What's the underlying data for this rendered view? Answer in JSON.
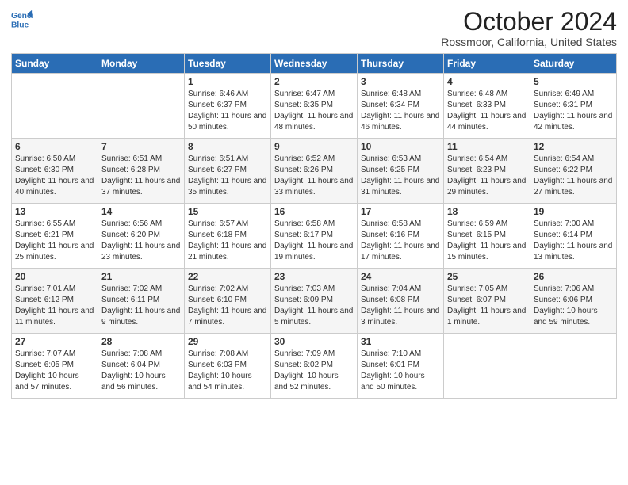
{
  "logo": {
    "line1": "General",
    "line2": "Blue"
  },
  "header": {
    "month": "October 2024",
    "location": "Rossmoor, California, United States"
  },
  "weekdays": [
    "Sunday",
    "Monday",
    "Tuesday",
    "Wednesday",
    "Thursday",
    "Friday",
    "Saturday"
  ],
  "weeks": [
    [
      {
        "day": "",
        "sunrise": "",
        "sunset": "",
        "daylight": ""
      },
      {
        "day": "",
        "sunrise": "",
        "sunset": "",
        "daylight": ""
      },
      {
        "day": "1",
        "sunrise": "Sunrise: 6:46 AM",
        "sunset": "Sunset: 6:37 PM",
        "daylight": "Daylight: 11 hours and 50 minutes."
      },
      {
        "day": "2",
        "sunrise": "Sunrise: 6:47 AM",
        "sunset": "Sunset: 6:35 PM",
        "daylight": "Daylight: 11 hours and 48 minutes."
      },
      {
        "day": "3",
        "sunrise": "Sunrise: 6:48 AM",
        "sunset": "Sunset: 6:34 PM",
        "daylight": "Daylight: 11 hours and 46 minutes."
      },
      {
        "day": "4",
        "sunrise": "Sunrise: 6:48 AM",
        "sunset": "Sunset: 6:33 PM",
        "daylight": "Daylight: 11 hours and 44 minutes."
      },
      {
        "day": "5",
        "sunrise": "Sunrise: 6:49 AM",
        "sunset": "Sunset: 6:31 PM",
        "daylight": "Daylight: 11 hours and 42 minutes."
      }
    ],
    [
      {
        "day": "6",
        "sunrise": "Sunrise: 6:50 AM",
        "sunset": "Sunset: 6:30 PM",
        "daylight": "Daylight: 11 hours and 40 minutes."
      },
      {
        "day": "7",
        "sunrise": "Sunrise: 6:51 AM",
        "sunset": "Sunset: 6:28 PM",
        "daylight": "Daylight: 11 hours and 37 minutes."
      },
      {
        "day": "8",
        "sunrise": "Sunrise: 6:51 AM",
        "sunset": "Sunset: 6:27 PM",
        "daylight": "Daylight: 11 hours and 35 minutes."
      },
      {
        "day": "9",
        "sunrise": "Sunrise: 6:52 AM",
        "sunset": "Sunset: 6:26 PM",
        "daylight": "Daylight: 11 hours and 33 minutes."
      },
      {
        "day": "10",
        "sunrise": "Sunrise: 6:53 AM",
        "sunset": "Sunset: 6:25 PM",
        "daylight": "Daylight: 11 hours and 31 minutes."
      },
      {
        "day": "11",
        "sunrise": "Sunrise: 6:54 AM",
        "sunset": "Sunset: 6:23 PM",
        "daylight": "Daylight: 11 hours and 29 minutes."
      },
      {
        "day": "12",
        "sunrise": "Sunrise: 6:54 AM",
        "sunset": "Sunset: 6:22 PM",
        "daylight": "Daylight: 11 hours and 27 minutes."
      }
    ],
    [
      {
        "day": "13",
        "sunrise": "Sunrise: 6:55 AM",
        "sunset": "Sunset: 6:21 PM",
        "daylight": "Daylight: 11 hours and 25 minutes."
      },
      {
        "day": "14",
        "sunrise": "Sunrise: 6:56 AM",
        "sunset": "Sunset: 6:20 PM",
        "daylight": "Daylight: 11 hours and 23 minutes."
      },
      {
        "day": "15",
        "sunrise": "Sunrise: 6:57 AM",
        "sunset": "Sunset: 6:18 PM",
        "daylight": "Daylight: 11 hours and 21 minutes."
      },
      {
        "day": "16",
        "sunrise": "Sunrise: 6:58 AM",
        "sunset": "Sunset: 6:17 PM",
        "daylight": "Daylight: 11 hours and 19 minutes."
      },
      {
        "day": "17",
        "sunrise": "Sunrise: 6:58 AM",
        "sunset": "Sunset: 6:16 PM",
        "daylight": "Daylight: 11 hours and 17 minutes."
      },
      {
        "day": "18",
        "sunrise": "Sunrise: 6:59 AM",
        "sunset": "Sunset: 6:15 PM",
        "daylight": "Daylight: 11 hours and 15 minutes."
      },
      {
        "day": "19",
        "sunrise": "Sunrise: 7:00 AM",
        "sunset": "Sunset: 6:14 PM",
        "daylight": "Daylight: 11 hours and 13 minutes."
      }
    ],
    [
      {
        "day": "20",
        "sunrise": "Sunrise: 7:01 AM",
        "sunset": "Sunset: 6:12 PM",
        "daylight": "Daylight: 11 hours and 11 minutes."
      },
      {
        "day": "21",
        "sunrise": "Sunrise: 7:02 AM",
        "sunset": "Sunset: 6:11 PM",
        "daylight": "Daylight: 11 hours and 9 minutes."
      },
      {
        "day": "22",
        "sunrise": "Sunrise: 7:02 AM",
        "sunset": "Sunset: 6:10 PM",
        "daylight": "Daylight: 11 hours and 7 minutes."
      },
      {
        "day": "23",
        "sunrise": "Sunrise: 7:03 AM",
        "sunset": "Sunset: 6:09 PM",
        "daylight": "Daylight: 11 hours and 5 minutes."
      },
      {
        "day": "24",
        "sunrise": "Sunrise: 7:04 AM",
        "sunset": "Sunset: 6:08 PM",
        "daylight": "Daylight: 11 hours and 3 minutes."
      },
      {
        "day": "25",
        "sunrise": "Sunrise: 7:05 AM",
        "sunset": "Sunset: 6:07 PM",
        "daylight": "Daylight: 11 hours and 1 minute."
      },
      {
        "day": "26",
        "sunrise": "Sunrise: 7:06 AM",
        "sunset": "Sunset: 6:06 PM",
        "daylight": "Daylight: 10 hours and 59 minutes."
      }
    ],
    [
      {
        "day": "27",
        "sunrise": "Sunrise: 7:07 AM",
        "sunset": "Sunset: 6:05 PM",
        "daylight": "Daylight: 10 hours and 57 minutes."
      },
      {
        "day": "28",
        "sunrise": "Sunrise: 7:08 AM",
        "sunset": "Sunset: 6:04 PM",
        "daylight": "Daylight: 10 hours and 56 minutes."
      },
      {
        "day": "29",
        "sunrise": "Sunrise: 7:08 AM",
        "sunset": "Sunset: 6:03 PM",
        "daylight": "Daylight: 10 hours and 54 minutes."
      },
      {
        "day": "30",
        "sunrise": "Sunrise: 7:09 AM",
        "sunset": "Sunset: 6:02 PM",
        "daylight": "Daylight: 10 hours and 52 minutes."
      },
      {
        "day": "31",
        "sunrise": "Sunrise: 7:10 AM",
        "sunset": "Sunset: 6:01 PM",
        "daylight": "Daylight: 10 hours and 50 minutes."
      },
      {
        "day": "",
        "sunrise": "",
        "sunset": "",
        "daylight": ""
      },
      {
        "day": "",
        "sunrise": "",
        "sunset": "",
        "daylight": ""
      }
    ]
  ]
}
